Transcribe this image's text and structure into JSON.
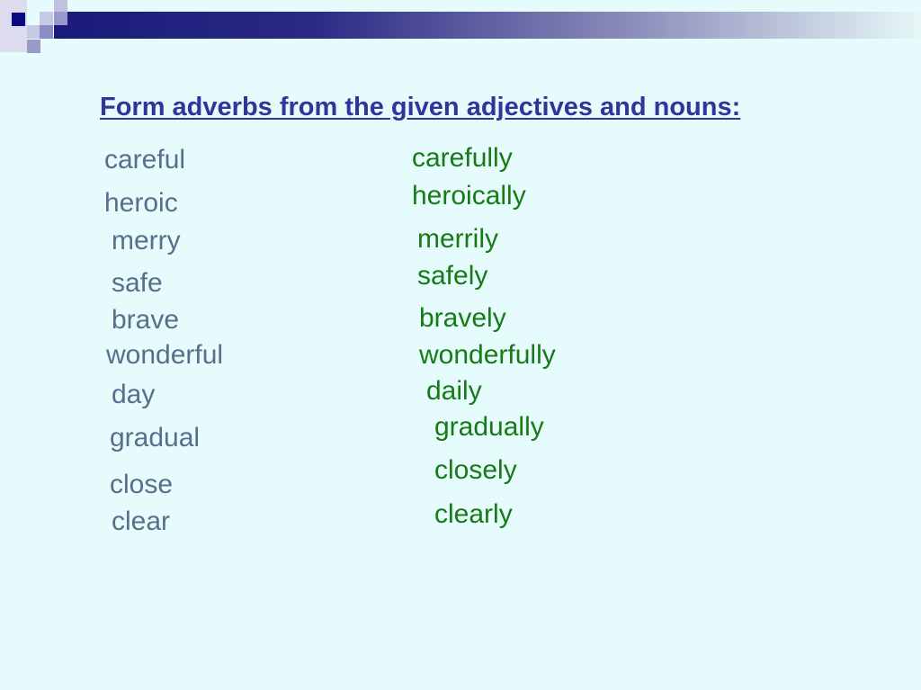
{
  "title": "Form adverbs from the given adjectives and nouns:",
  "colors": {
    "title": "#33339a",
    "adjectives": "#5a6e8c",
    "adverbs": "#167a16",
    "background": "#e6fcfc",
    "bar": "#1a1a7a"
  },
  "pairs": [
    {
      "word": "careful",
      "adverb": "carefully"
    },
    {
      "word": "heroic",
      "adverb": "heroically"
    },
    {
      "word": "merry",
      "adverb": "merrily"
    },
    {
      "word": "safe",
      "adverb": "safely"
    },
    {
      "word": "brave",
      "adverb": "bravely"
    },
    {
      "word": "wonderful",
      "adverb": "wonderfully"
    },
    {
      "word": "day",
      "adverb": "daily"
    },
    {
      "word": "gradual",
      "adverb": "gradually"
    },
    {
      "word": "close",
      "adverb": "closely"
    },
    {
      "word": "clear",
      "adverb": "clearly"
    }
  ]
}
